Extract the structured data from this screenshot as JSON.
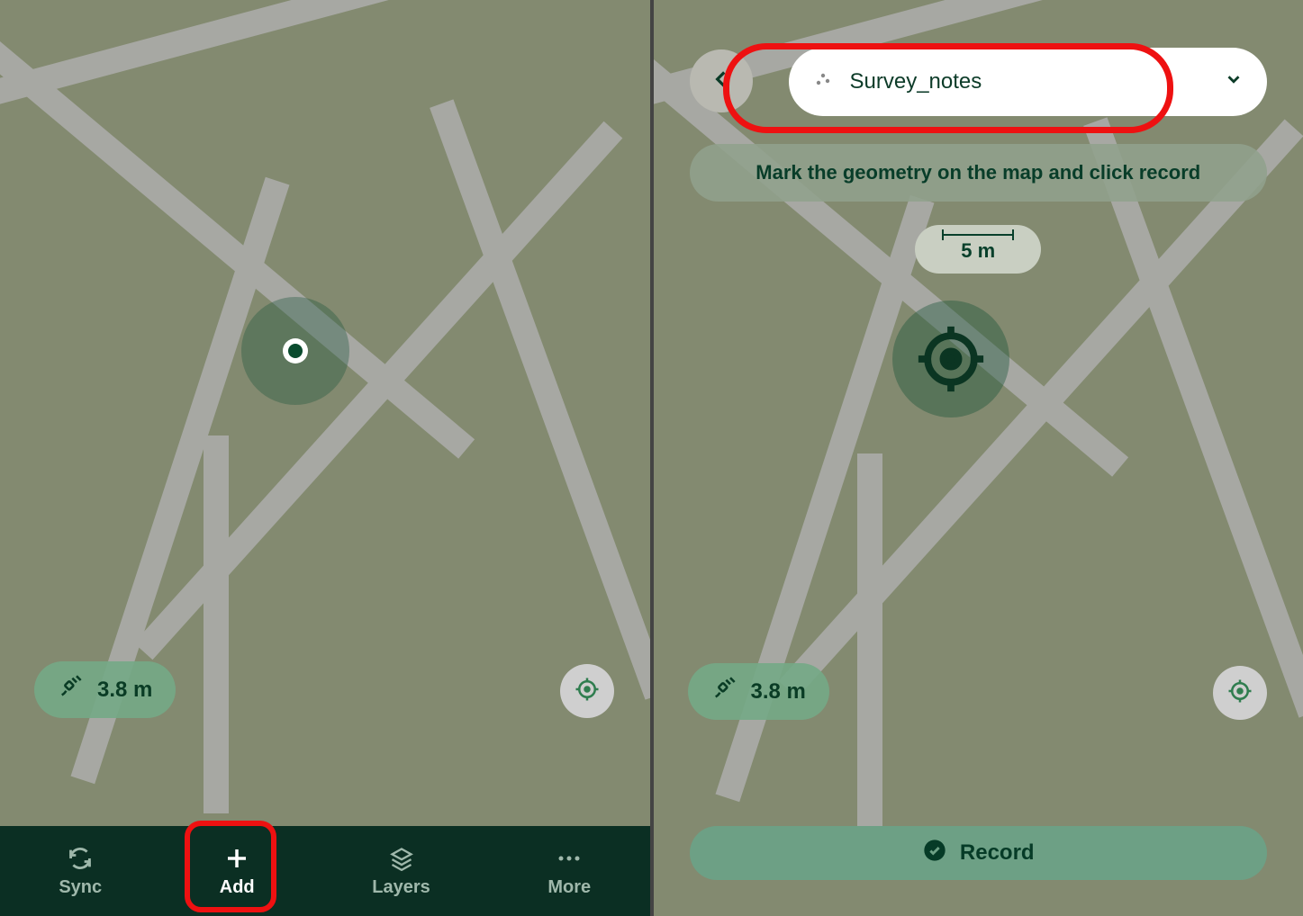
{
  "left": {
    "gps_accuracy": "3.8 m",
    "nav": {
      "sync": "Sync",
      "add": "Add",
      "layers": "Layers",
      "more": "More"
    }
  },
  "right": {
    "layer_selector": "Survey_notes",
    "hint": "Mark the geometry on the map and click record",
    "scale_label": "5 m",
    "gps_accuracy": "3.8 m",
    "record_label": "Record"
  },
  "colors": {
    "primary_dark": "#0b2f23",
    "accent_red": "#e11"
  },
  "icons": {
    "sync": "sync-icon",
    "add": "plus-icon",
    "layers": "layers-icon",
    "more": "dots-icon",
    "back": "chevron-left-icon",
    "dropdown": "chevron-down-icon",
    "locate": "crosshair-icon",
    "satellite": "satellite-icon",
    "check": "check-circle-icon",
    "reticle": "target-reticle-icon",
    "layer_dots": "scatter-dots-icon"
  }
}
